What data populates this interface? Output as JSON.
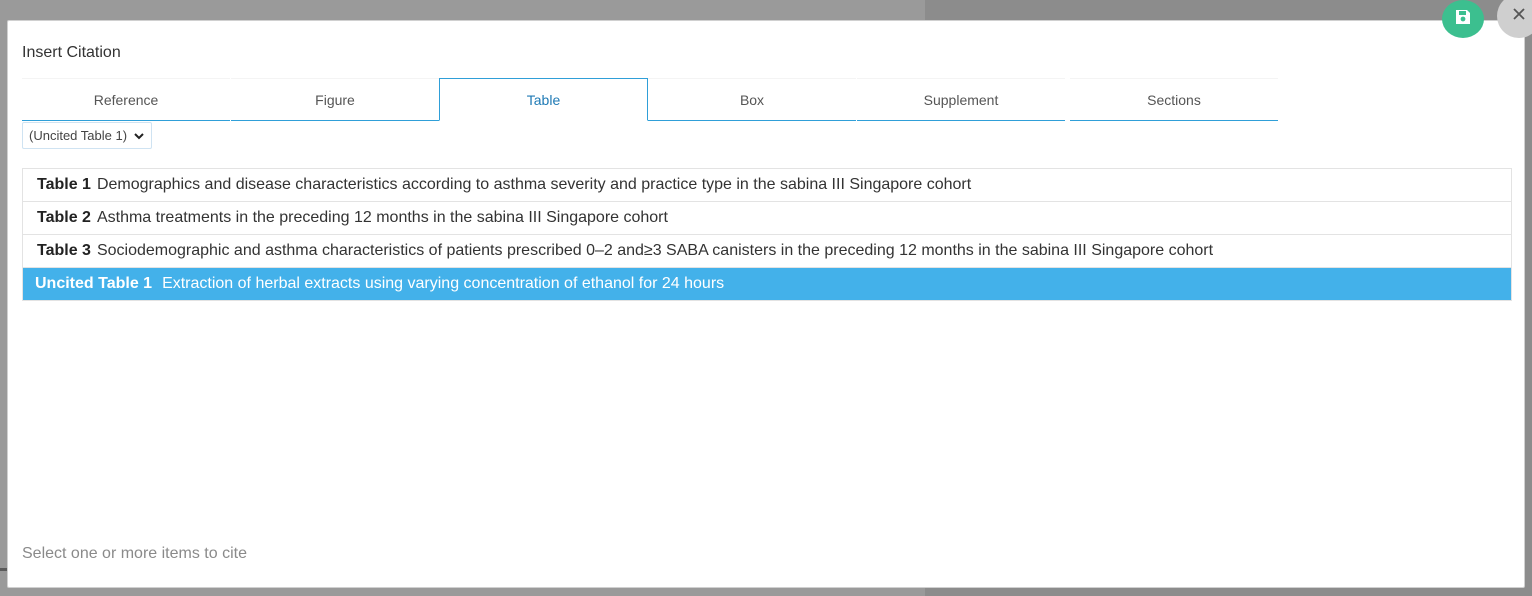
{
  "dialog": {
    "title": "Insert Citation",
    "footer_hint": "Select one or more items to cite"
  },
  "tabs": [
    {
      "label": "Reference"
    },
    {
      "label": "Figure"
    },
    {
      "label": "Table",
      "active": true
    },
    {
      "label": "Box"
    },
    {
      "label": "Supplement"
    },
    {
      "label": "Sections"
    }
  ],
  "filter": {
    "selected": "(Uncited Table 1)"
  },
  "items": [
    {
      "label": "Table 1",
      "caption": "Demographics and disease characteristics according to asthma severity and practice type in the sabina III Singapore cohort",
      "selected": false
    },
    {
      "label": "Table 2",
      "caption": "Asthma treatments in the preceding 12 months in the sabina III Singapore cohort",
      "selected": false
    },
    {
      "label": "Table 3",
      "caption": "Sociodemographic and asthma characteristics of patients prescribed 0–2 and≥3 SABA canisters in the preceding 12 months in the sabina III Singapore cohort",
      "selected": false
    },
    {
      "label": "Uncited Table 1",
      "caption": "Extraction of herbal extracts using varying concentration of ethanol for 24 hours",
      "selected": true
    }
  ],
  "icons": {
    "save": "floppy-disk-icon",
    "close": "close-icon",
    "dropdown": "chevron-down-icon"
  },
  "colors": {
    "accent": "#2f9fd8",
    "selected_row": "#43b1ea",
    "save_button": "#3cbf8f"
  }
}
